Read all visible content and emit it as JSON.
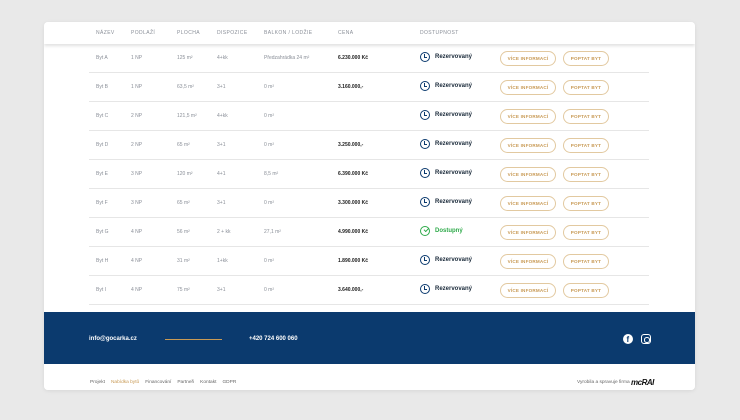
{
  "table": {
    "headers": [
      "NÁZEV",
      "PODLAŽÍ",
      "PLOCHA",
      "DISPOZICE",
      "BALKON / LODŽIE",
      "CENA",
      "DOSTUPNOST"
    ],
    "more_label": "VÍCE INFORMACÍ",
    "ask_label": "POPTAT BYT",
    "rows": [
      {
        "name": "Byt A",
        "floor": "1 NP",
        "area": "125 m²",
        "layout": "4+kk",
        "balcony": "Předzahrádka 24 m²",
        "price": "6.230.000 Kč",
        "status": "Rezervovaný",
        "available": false
      },
      {
        "name": "Byt B",
        "floor": "1 NP",
        "area": "63,5 m²",
        "layout": "3+1",
        "balcony": "0 m²",
        "price": "3.160.000,-",
        "status": "Rezervovaný",
        "available": false
      },
      {
        "name": "Byt C",
        "floor": "2 NP",
        "area": "121,5 m²",
        "layout": "4+kk",
        "balcony": "0 m²",
        "price": "",
        "status": "Rezervovaný",
        "available": false
      },
      {
        "name": "Byt D",
        "floor": "2 NP",
        "area": "65 m²",
        "layout": "3+1",
        "balcony": "0 m²",
        "price": "3.250.000,-",
        "status": "Rezervovaný",
        "available": false
      },
      {
        "name": "Byt E",
        "floor": "3 NP",
        "area": "120 m²",
        "layout": "4+1",
        "balcony": "8,5 m²",
        "price": "6.390.000 Kč",
        "status": "Rezervovaný",
        "available": false
      },
      {
        "name": "Byt F",
        "floor": "3 NP",
        "area": "65 m²",
        "layout": "3+1",
        "balcony": "0 m²",
        "price": "3.300.000 Kč",
        "status": "Rezervovaný",
        "available": false
      },
      {
        "name": "Byt G",
        "floor": "4 NP",
        "area": "56 m²",
        "layout": "2 + kk",
        "balcony": "27,1 m²",
        "price": "4.990.000 Kč",
        "status": "Dostupný",
        "available": true
      },
      {
        "name": "Byt H",
        "floor": "4 NP",
        "area": "31 m²",
        "layout": "1+kk",
        "balcony": "0 m²",
        "price": "1.890.000 Kč",
        "status": "Rezervovaný",
        "available": false
      },
      {
        "name": "Byt I",
        "floor": "4 NP",
        "area": "75 m²",
        "layout": "3+1",
        "balcony": "0 m²",
        "price": "3.640.000,-",
        "status": "Rezervovaný",
        "available": false
      }
    ]
  },
  "footer": {
    "email": "info@gocarka.cz",
    "phone": "+420 724 600 060",
    "social": [
      "facebook-icon",
      "instagram-icon"
    ]
  },
  "bottom": {
    "links": [
      "Projekt",
      "Nabídka bytů",
      "Financování",
      "Partneři",
      "Kontakt",
      "GDPR"
    ],
    "active_link": "Nabídka bytů",
    "credit": "Vyrobila a spravuje firma",
    "logo": "mcRAI"
  },
  "colors": {
    "accent": "#c89a55",
    "navy": "#0b3a6e",
    "available": "#2eaa4a",
    "background": "#e9e9e9"
  }
}
